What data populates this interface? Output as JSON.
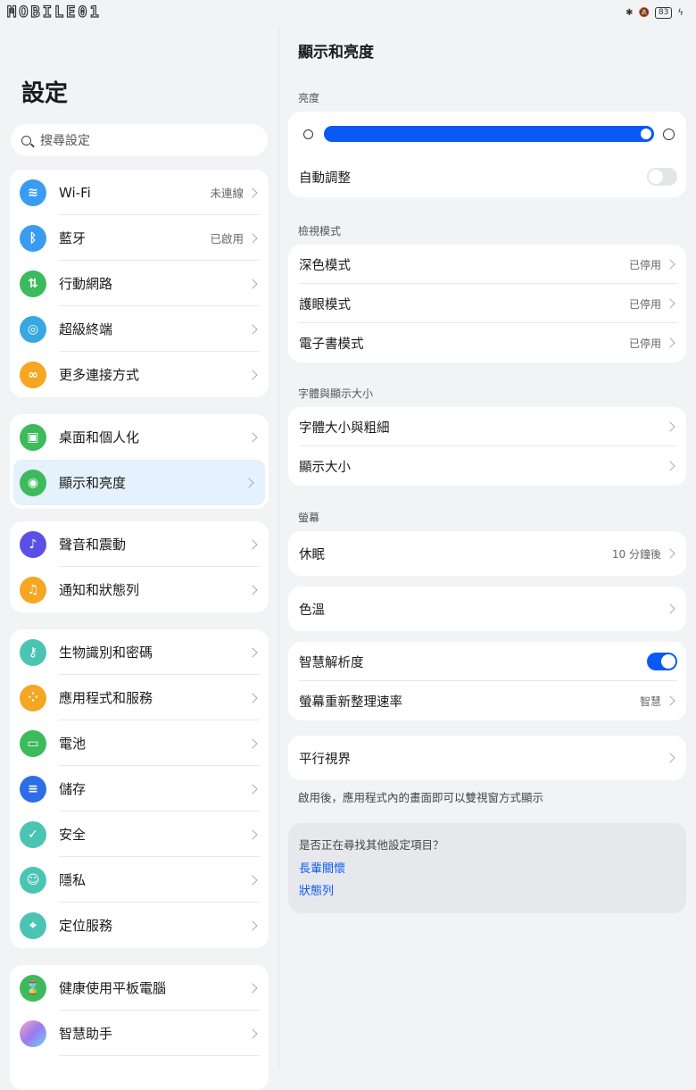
{
  "status": {
    "logo": "MOBILE01",
    "battery": "83"
  },
  "left": {
    "title": "設定",
    "search_placeholder": "搜尋設定",
    "groups": [
      {
        "items": [
          {
            "label": "Wi-Fi",
            "value": "未連線",
            "icon": "wifi-icon",
            "color": "#3a9cf0"
          },
          {
            "label": "藍牙",
            "value": "已啟用",
            "icon": "bluetooth-icon",
            "color": "#3a9cf0"
          },
          {
            "label": "行動網路",
            "value": "",
            "icon": "mobile-data-icon",
            "color": "#3dbb5c"
          },
          {
            "label": "超級終端",
            "value": "",
            "icon": "super-device-icon",
            "color": "#39a8e0"
          },
          {
            "label": "更多連接方式",
            "value": "",
            "icon": "link-icon",
            "color": "#f5a623"
          }
        ]
      },
      {
        "items": [
          {
            "label": "桌面和個人化",
            "value": "",
            "icon": "wallpaper-icon",
            "color": "#3dbb5c"
          },
          {
            "label": "顯示和亮度",
            "value": "",
            "icon": "eye-icon",
            "color": "#3dbb5c"
          }
        ]
      },
      {
        "items": [
          {
            "label": "聲音和震動",
            "value": "",
            "icon": "sound-icon",
            "color": "#5a50e6"
          },
          {
            "label": "通知和狀態列",
            "value": "",
            "icon": "bell-icon",
            "color": "#f5a623"
          }
        ]
      },
      {
        "items": [
          {
            "label": "生物識別和密碼",
            "value": "",
            "icon": "key-icon",
            "color": "#4cc4b4"
          },
          {
            "label": "應用程式和服務",
            "value": "",
            "icon": "apps-icon",
            "color": "#f5a623"
          },
          {
            "label": "電池",
            "value": "",
            "icon": "battery-icon",
            "color": "#3dbb5c"
          },
          {
            "label": "儲存",
            "value": "",
            "icon": "storage-icon",
            "color": "#2d6ee8"
          },
          {
            "label": "安全",
            "value": "",
            "icon": "shield-icon",
            "color": "#4cc4b4"
          },
          {
            "label": "隱私",
            "value": "",
            "icon": "privacy-icon",
            "color": "#4cc4b4"
          },
          {
            "label": "定位服務",
            "value": "",
            "icon": "location-icon",
            "color": "#4cc4b4"
          }
        ]
      },
      {
        "items": [
          {
            "label": "健康使用平板電腦",
            "value": "",
            "icon": "hourglass-icon",
            "color": "#3dbb5c"
          },
          {
            "label": "智慧助手",
            "value": "",
            "icon": "assistant-icon",
            "color": "#c07ae8"
          }
        ]
      }
    ]
  },
  "right": {
    "title": "顯示和亮度",
    "brightness_header": "亮度",
    "brightness_level_pct": 100,
    "auto_adjust": "自動調整",
    "view_header": "檢視模式",
    "dark_mode": "深色模式",
    "eye_comfort": "護眼模式",
    "ebook": "電子書模式",
    "disabled": "已停用",
    "font_header": "字體與顯示大小",
    "font_size": "字體大小與粗細",
    "display_size": "顯示大小",
    "screen_header": "螢幕",
    "sleep": "休眠",
    "sleep_value": "10 分鐘後",
    "color_temp": "色溫",
    "smart_res": "智慧解析度",
    "refresh_rate": "螢幕重新整理速率",
    "refresh_value": "智慧",
    "parallel": "平行視界",
    "parallel_note": "啟用後，應用程式內的畫面即可以雙視窗方式顯示",
    "help_q": "是否正在尋找其他設定項目？",
    "help_link1": "長輩關懷",
    "help_link2": "狀態列"
  }
}
